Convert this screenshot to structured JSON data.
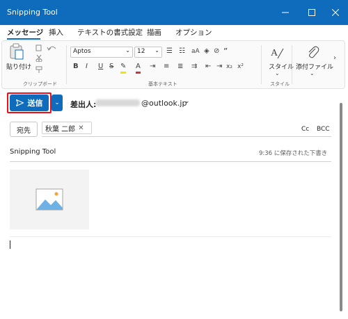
{
  "window": {
    "title": "Snipping Tool"
  },
  "tabs": [
    {
      "label": "メッセージ",
      "active": true
    },
    {
      "label": "挿入"
    },
    {
      "label": "テキストの書式設定"
    },
    {
      "label": "描画"
    },
    {
      "label": "オプション"
    }
  ],
  "ribbon": {
    "paste_label": "貼り付け",
    "clipboard_group": "クリップボード",
    "font_name": "Aptos",
    "font_size": "12",
    "basic_text_group": "基本テキスト",
    "style_label": "スタイル",
    "style_group": "スタイル",
    "attach_label": "添付ファイル"
  },
  "compose": {
    "send_label": "送信",
    "from_label": "差出人:",
    "from_domain": "@outlook.jp",
    "to_button": "宛先",
    "recipient": "秋葉 二郎",
    "cc": "Cc",
    "bcc": "BCC",
    "subject": "Snipping Tool",
    "saved_status": "9:36 に保存された下書き"
  },
  "colors": {
    "accent": "#0f6cbd",
    "highlight_border": "#e8111b"
  }
}
